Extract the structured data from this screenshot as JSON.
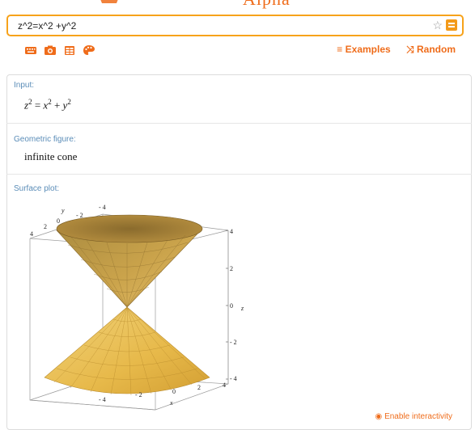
{
  "search": {
    "query": "z^2=x^2 +y^2"
  },
  "toolbar": {
    "icons": [
      "keyboard-icon",
      "camera-icon",
      "table-icon",
      "palette-icon"
    ],
    "examples_label": "Examples",
    "random_label": "Random"
  },
  "pods": {
    "input": {
      "title": "Input:"
    },
    "geometric": {
      "title": "Geometric figure:",
      "value": "infinite cone"
    },
    "surface": {
      "title": "Surface plot:"
    }
  },
  "plot": {
    "y_label": "y",
    "x_label": "x",
    "z_label": "z",
    "y_ticks": [
      "- 4",
      "- 2",
      "0",
      "2",
      "4"
    ],
    "x_ticks": [
      "- 4",
      "- 2",
      "0",
      "2",
      "4"
    ],
    "z_ticks": [
      "4",
      "2",
      "0",
      "- 2",
      "- 4"
    ]
  },
  "enable_label": "Enable interactivity",
  "colors": {
    "accent": "#ef6c1a",
    "search_border": "#f7a21a",
    "pod_title": "#5b8db8",
    "cone": "#e9b94a"
  }
}
